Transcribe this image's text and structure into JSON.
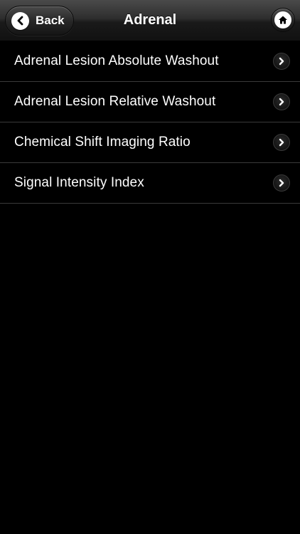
{
  "header": {
    "title": "Adrenal",
    "back_label": "Back",
    "back_icon": "chevron-left-icon",
    "home_icon": "home-icon"
  },
  "list": {
    "items": [
      {
        "label": "Adrenal Lesion Absolute Washout",
        "icon": "chevron-right-icon"
      },
      {
        "label": "Adrenal Lesion Relative Washout",
        "icon": "chevron-right-icon"
      },
      {
        "label": "Chemical Shift Imaging Ratio",
        "icon": "chevron-right-icon"
      },
      {
        "label": "Signal Intensity Index",
        "icon": "chevron-right-icon"
      }
    ]
  },
  "colors": {
    "background": "#000000",
    "text": "#ffffff",
    "divider": "#3a3a3a"
  }
}
